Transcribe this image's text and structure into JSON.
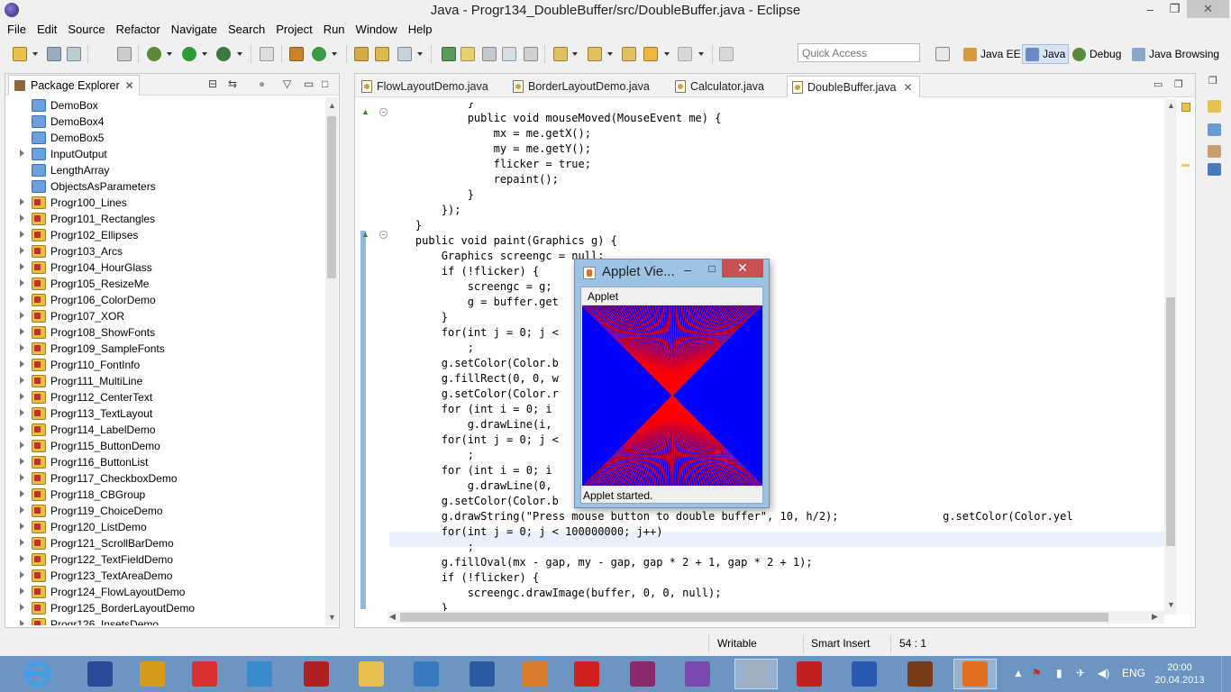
{
  "window": {
    "title": "Java - Progr134_DoubleBuffer/src/DoubleBuffer.java - Eclipse",
    "min": "–",
    "max": "❐",
    "close": "✕"
  },
  "menu": [
    "File",
    "Edit",
    "Source",
    "Refactor",
    "Navigate",
    "Search",
    "Project",
    "Run",
    "Window",
    "Help"
  ],
  "toolbar": {
    "quick_access_placeholder": "Quick Access"
  },
  "perspectives": [
    {
      "label": "Java EE",
      "active": false
    },
    {
      "label": "Java",
      "active": true
    },
    {
      "label": "Debug",
      "active": false
    },
    {
      "label": "Java Browsing",
      "active": false
    }
  ],
  "package_explorer": {
    "tab_label": "Package Explorer",
    "tab_close": "✕",
    "items": [
      {
        "label": "DemoBox",
        "type": "folder",
        "expandable": false
      },
      {
        "label": "DemoBox4",
        "type": "folder",
        "expandable": false
      },
      {
        "label": "DemoBox5",
        "type": "folder",
        "expandable": false
      },
      {
        "label": "InputOutput",
        "type": "folder",
        "expandable": true
      },
      {
        "label": "LengthArray",
        "type": "folder",
        "expandable": false
      },
      {
        "label": "ObjectsAsParameters",
        "type": "folder",
        "expandable": false
      },
      {
        "label": "Progr100_Lines",
        "type": "project",
        "expandable": true
      },
      {
        "label": "Progr101_Rectangles",
        "type": "project",
        "expandable": true
      },
      {
        "label": "Progr102_Ellipses",
        "type": "project",
        "expandable": true
      },
      {
        "label": "Progr103_Arcs",
        "type": "project",
        "expandable": true
      },
      {
        "label": "Progr104_HourGlass",
        "type": "project",
        "expandable": true
      },
      {
        "label": "Progr105_ResizeMe",
        "type": "project",
        "expandable": true
      },
      {
        "label": "Progr106_ColorDemo",
        "type": "project",
        "expandable": true
      },
      {
        "label": "Progr107_XOR",
        "type": "project",
        "expandable": true
      },
      {
        "label": "Progr108_ShowFonts",
        "type": "project",
        "expandable": true
      },
      {
        "label": "Progr109_SampleFonts",
        "type": "project",
        "expandable": true
      },
      {
        "label": "Progr110_FontInfo",
        "type": "project",
        "expandable": true
      },
      {
        "label": "Progr111_MultiLine",
        "type": "project",
        "expandable": true
      },
      {
        "label": "Progr112_CenterText",
        "type": "project",
        "expandable": true
      },
      {
        "label": "Progr113_TextLayout",
        "type": "project",
        "expandable": true
      },
      {
        "label": "Progr114_LabelDemo",
        "type": "project",
        "expandable": true
      },
      {
        "label": "Progr115_ButtonDemo",
        "type": "project",
        "expandable": true
      },
      {
        "label": "Progr116_ButtonList",
        "type": "project",
        "expandable": true
      },
      {
        "label": "Progr117_CheckboxDemo",
        "type": "project",
        "expandable": true
      },
      {
        "label": "Progr118_CBGroup",
        "type": "project",
        "expandable": true
      },
      {
        "label": "Progr119_ChoiceDemo",
        "type": "project",
        "expandable": true
      },
      {
        "label": "Progr120_ListDemo",
        "type": "project",
        "expandable": true
      },
      {
        "label": "Progr121_ScrollBarDemo",
        "type": "project",
        "expandable": true
      },
      {
        "label": "Progr122_TextFieldDemo",
        "type": "project",
        "expandable": true
      },
      {
        "label": "Progr123_TextAreaDemo",
        "type": "project",
        "expandable": true
      },
      {
        "label": "Progr124_FlowLayoutDemo",
        "type": "project",
        "expandable": true
      },
      {
        "label": "Progr125_BorderLayoutDemo",
        "type": "project",
        "expandable": true
      },
      {
        "label": "Progr126_InsetsDemo",
        "type": "project",
        "expandable": true
      }
    ]
  },
  "editor": {
    "tabs": [
      {
        "label": "FlowLayoutDemo.java",
        "active": false
      },
      {
        "label": "BorderLayoutDemo.java",
        "active": false
      },
      {
        "label": "Calculator.java",
        "active": false
      },
      {
        "label": "DoubleBuffer.java",
        "active": true
      }
    ],
    "active_tab_close": "✕",
    "lines": [
      "            }",
      "            public void mouseMoved(MouseEvent me) {",
      "                mx = me.getX();",
      "                my = me.getY();",
      "                flicker = true;",
      "                repaint();",
      "            }",
      "        });",
      "    }",
      "    public void paint(Graphics g) {",
      "        Graphics screengc = null;",
      "        if (!flicker) {",
      "            screengc = g;",
      "            g = buffer.get",
      "        }",
      "        for(int j = 0; j <",
      "            ;",
      "        g.setColor(Color.b",
      "        g.fillRect(0, 0, w",
      "        g.setColor(Color.r",
      "        for (int i = 0; i",
      "            g.drawLine(i,",
      "        for(int j = 0; j <",
      "            ;",
      "        for (int i = 0; i",
      "            g.drawLine(0,",
      "        g.setColor(Color.b",
      "        g.drawString(\"Press mouse button to double buffer\", 10, h/2);                g.setColor(Color.yel",
      "        for(int j = 0; j < 100000000; j++)",
      "            ;",
      "        g.fillOval(mx - gap, my - gap, gap * 2 + 1, gap * 2 + 1);",
      "        if (!flicker) {",
      "            screengc.drawImage(buffer, 0, 0, null);",
      "        }"
    ]
  },
  "applet": {
    "title": "Applet Vie...",
    "menu": "Applet",
    "status": "Applet started.",
    "close": "✕",
    "line_color": "#ff0000",
    "bg_color": "#0000ff"
  },
  "statusbar": {
    "mode": "Writable",
    "insert": "Smart Insert",
    "position": "54 : 1"
  },
  "taskbar": {
    "apps": [
      "internet-explorer",
      "help",
      "globe",
      "yandex",
      "mail",
      "winrar-setup",
      "file-explorer",
      "control-panel",
      "translator",
      "network",
      "1c",
      "winrar",
      "pen-tool",
      "monitor",
      "filezilla",
      "word",
      "java-ee-ide",
      "java"
    ],
    "lang": "ENG",
    "time": "20:00",
    "date": "20.04.2013"
  },
  "colors": {
    "taskbar": "#6d95c2",
    "keyword": "#7f0055",
    "field": "#0000c0",
    "string": "#2a00ff"
  }
}
